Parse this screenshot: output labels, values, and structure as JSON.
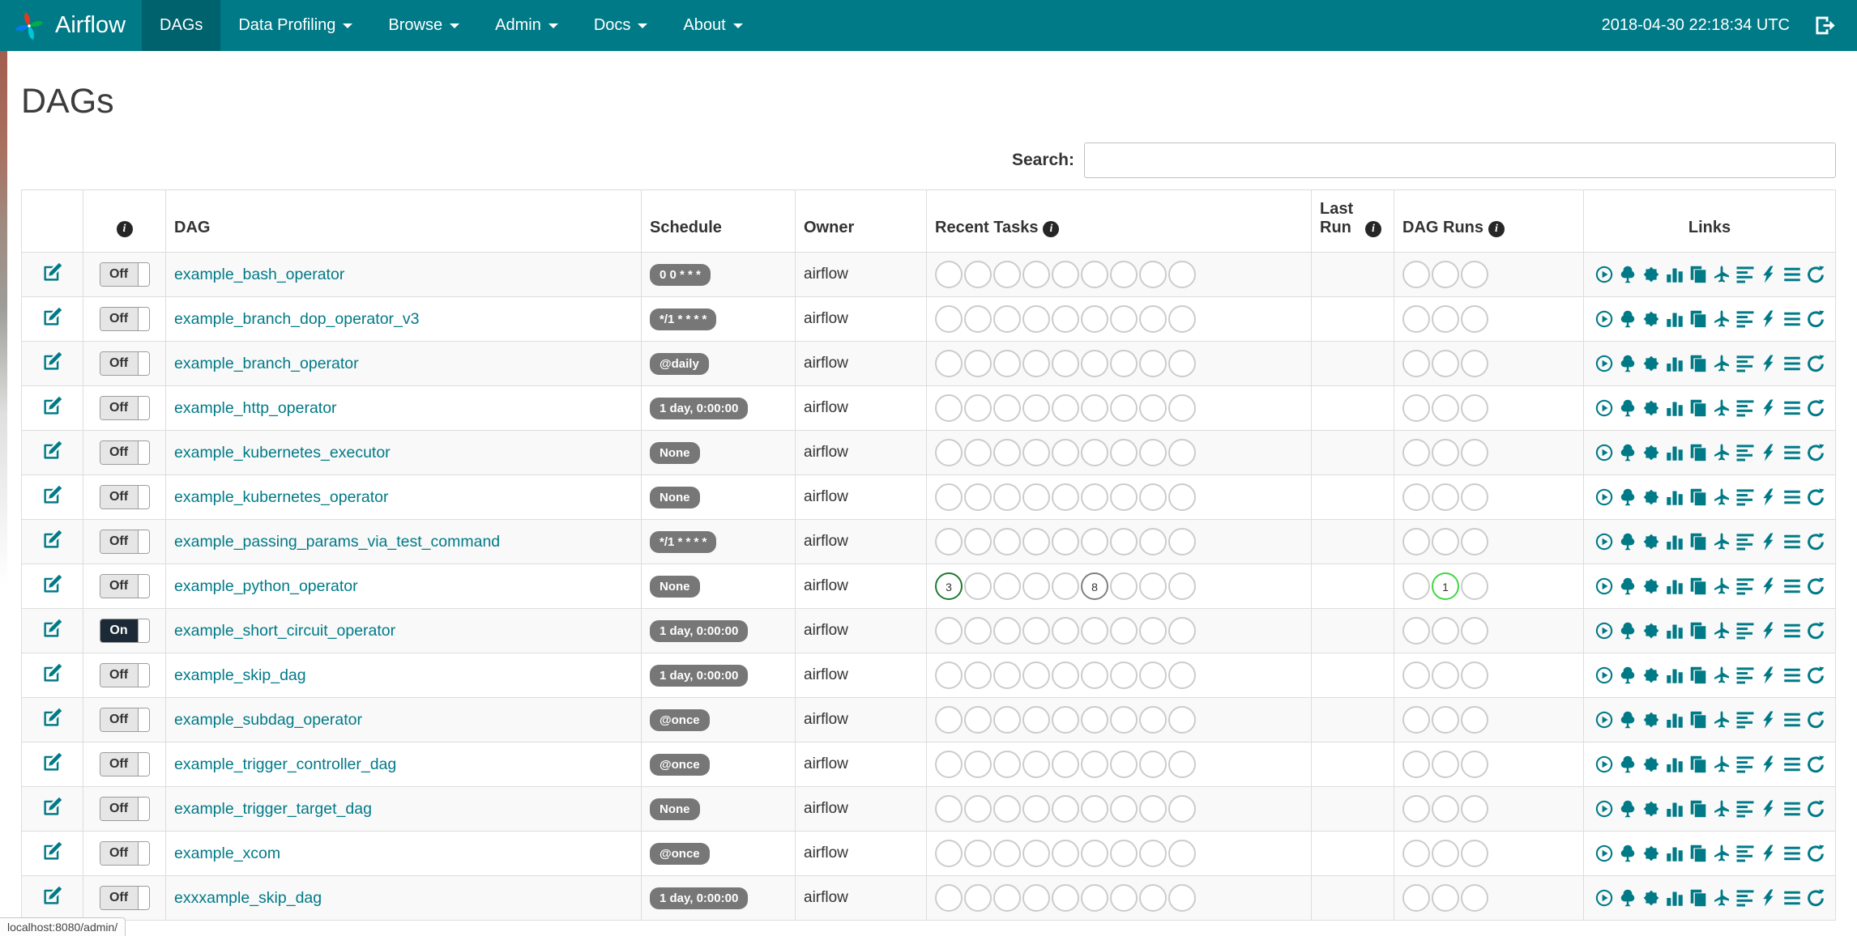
{
  "navbar": {
    "brand": "Airflow",
    "clock": "2018-04-30 22:18:34 UTC",
    "items": [
      {
        "label": "DAGs",
        "active": true,
        "dropdown": false
      },
      {
        "label": "Data Profiling",
        "active": false,
        "dropdown": true
      },
      {
        "label": "Browse",
        "active": false,
        "dropdown": true
      },
      {
        "label": "Admin",
        "active": false,
        "dropdown": true
      },
      {
        "label": "Docs",
        "active": false,
        "dropdown": true
      },
      {
        "label": "About",
        "active": false,
        "dropdown": true
      }
    ]
  },
  "page": {
    "title": "DAGs",
    "status_bar": "localhost:8080/admin/"
  },
  "search": {
    "label": "Search:",
    "value": ""
  },
  "table": {
    "columns": {
      "edit": "",
      "info": "",
      "dag": "DAG",
      "schedule": "Schedule",
      "owner": "Owner",
      "recent_tasks": "Recent Tasks",
      "last_run": "Last Run",
      "dag_runs": "DAG Runs",
      "links": "Links"
    },
    "circles": {
      "recent_tasks": 9,
      "dag_runs": 3
    }
  },
  "links": [
    {
      "name": "trigger-dag",
      "icon": "play-circle"
    },
    {
      "name": "tree-view",
      "icon": "tree"
    },
    {
      "name": "graph-view",
      "icon": "sunburst"
    },
    {
      "name": "task-duration",
      "icon": "bar-chart"
    },
    {
      "name": "task-tries",
      "icon": "duplicate"
    },
    {
      "name": "landing-times",
      "icon": "plane"
    },
    {
      "name": "gantt-view",
      "icon": "align-left"
    },
    {
      "name": "code-view",
      "icon": "flash"
    },
    {
      "name": "logs",
      "icon": "list"
    },
    {
      "name": "refresh",
      "icon": "refresh"
    }
  ],
  "colors": {
    "navbar_bg": "#007a87",
    "navbar_active_bg": "#00626d",
    "link_teal": "#007a87",
    "schedule_badge_bg": "#777777",
    "toggle_on_bg": "#1b2a36",
    "states": {
      "success": "#1f7a33",
      "running": "#44d544",
      "queued": "#808080",
      "none": "#cccccc"
    }
  },
  "dags": [
    {
      "name": "example_bash_operator",
      "schedule": "0 0 * * *",
      "owner": "airflow",
      "toggle_label": "Off",
      "paused": true,
      "last_run": "",
      "task_counts": {},
      "run_counts": {}
    },
    {
      "name": "example_branch_dop_operator_v3",
      "schedule": "*/1 * * * *",
      "owner": "airflow",
      "toggle_label": "Off",
      "paused": true,
      "last_run": "",
      "task_counts": {},
      "run_counts": {}
    },
    {
      "name": "example_branch_operator",
      "schedule": "@daily",
      "owner": "airflow",
      "toggle_label": "Off",
      "paused": true,
      "last_run": "",
      "task_counts": {},
      "run_counts": {}
    },
    {
      "name": "example_http_operator",
      "schedule": "1 day, 0:00:00",
      "owner": "airflow",
      "toggle_label": "Off",
      "paused": true,
      "last_run": "",
      "task_counts": {},
      "run_counts": {}
    },
    {
      "name": "example_kubernetes_executor",
      "schedule": "None",
      "owner": "airflow",
      "toggle_label": "Off",
      "paused": true,
      "last_run": "",
      "task_counts": {},
      "run_counts": {}
    },
    {
      "name": "example_kubernetes_operator",
      "schedule": "None",
      "owner": "airflow",
      "toggle_label": "Off",
      "paused": true,
      "last_run": "",
      "task_counts": {},
      "run_counts": {}
    },
    {
      "name": "example_passing_params_via_test_command",
      "schedule": "*/1 * * * *",
      "owner": "airflow",
      "toggle_label": "Off",
      "paused": true,
      "last_run": "",
      "task_counts": {},
      "run_counts": {}
    },
    {
      "name": "example_python_operator",
      "schedule": "None",
      "owner": "airflow",
      "toggle_label": "Off",
      "paused": true,
      "last_run": "",
      "task_counts": {
        "0": {
          "n": 3,
          "state": "success"
        },
        "5": {
          "n": 8,
          "state": "queued"
        }
      },
      "run_counts": {
        "1": {
          "n": 1,
          "state": "running"
        }
      }
    },
    {
      "name": "example_short_circuit_operator",
      "schedule": "1 day, 0:00:00",
      "owner": "airflow",
      "toggle_label": "On",
      "paused": false,
      "last_run": "",
      "task_counts": {},
      "run_counts": {}
    },
    {
      "name": "example_skip_dag",
      "schedule": "1 day, 0:00:00",
      "owner": "airflow",
      "toggle_label": "Off",
      "paused": true,
      "last_run": "",
      "task_counts": {},
      "run_counts": {}
    },
    {
      "name": "example_subdag_operator",
      "schedule": "@once",
      "owner": "airflow",
      "toggle_label": "Off",
      "paused": true,
      "last_run": "",
      "task_counts": {},
      "run_counts": {}
    },
    {
      "name": "example_trigger_controller_dag",
      "schedule": "@once",
      "owner": "airflow",
      "toggle_label": "Off",
      "paused": true,
      "last_run": "",
      "task_counts": {},
      "run_counts": {}
    },
    {
      "name": "example_trigger_target_dag",
      "schedule": "None",
      "owner": "airflow",
      "toggle_label": "Off",
      "paused": true,
      "last_run": "",
      "task_counts": {},
      "run_counts": {}
    },
    {
      "name": "example_xcom",
      "schedule": "@once",
      "owner": "airflow",
      "toggle_label": "Off",
      "paused": true,
      "last_run": "",
      "task_counts": {},
      "run_counts": {}
    },
    {
      "name": "exxxample_skip_dag",
      "schedule": "1 day, 0:00:00",
      "owner": "airflow",
      "toggle_label": "Off",
      "paused": true,
      "last_run": "",
      "task_counts": {},
      "run_counts": {}
    }
  ]
}
